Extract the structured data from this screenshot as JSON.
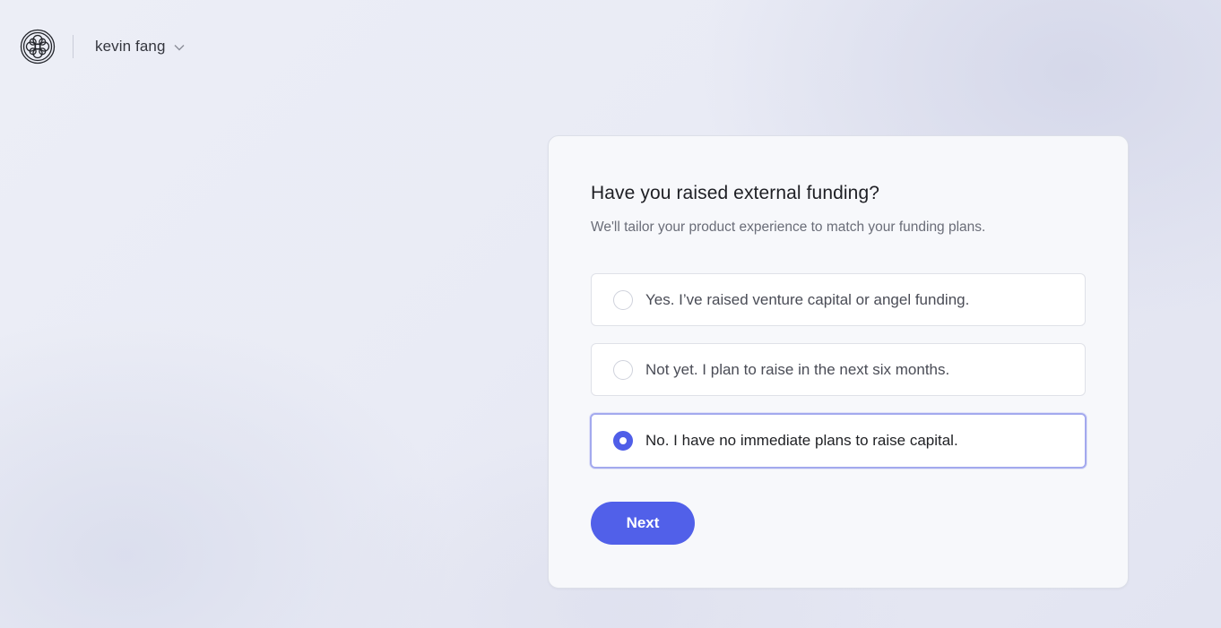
{
  "header": {
    "logo_icon": "ornate-knot-logo-icon",
    "user_name": "kevin fang",
    "user_menu_icon": "chevron-down-icon"
  },
  "question": {
    "title": "Have you raised external funding?",
    "subtitle": "We'll tailor your product experience to match your funding plans.",
    "options": [
      {
        "label": "Yes. I’ve raised venture capital or angel funding.",
        "selected": false
      },
      {
        "label": "Not yet. I plan to raise in the next six months.",
        "selected": false
      },
      {
        "label": "No. I have no immediate plans to raise capital.",
        "selected": true
      }
    ],
    "next_label": "Next"
  },
  "colors": {
    "accent": "#5160e9",
    "selected_border": "#a3a9ee",
    "background": "#eceef6"
  }
}
